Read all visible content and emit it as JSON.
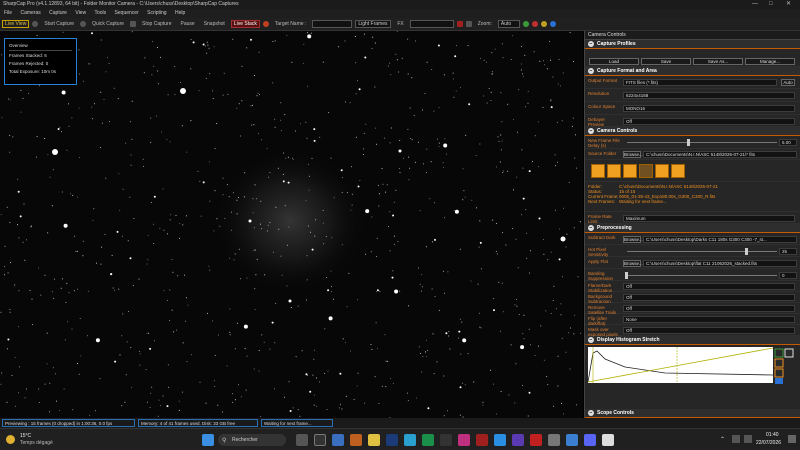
{
  "window": {
    "title": "SharpCap Pro (v4.1.12893, 64 bit) - Folder Monitor Camera - C:\\Users\\chuss\\Desktop\\SharpCap Captures"
  },
  "menu": [
    "File",
    "Cameras",
    "Capture",
    "View",
    "Tools",
    "Sequencer",
    "Scripting",
    "Help"
  ],
  "toolbar": {
    "live_view": "Live View",
    "start_capture": "Start Capture",
    "quick_capture": "Quick Capture",
    "stop_capture": "Stop Capture",
    "pause": "Pause",
    "snapshot": "Snapshot",
    "live_stack": "Live Stack",
    "target_name_label": "Target Name :",
    "target_name_value": "",
    "light_frames": "Light Frames",
    "fx_label": "FX",
    "fx_value": "",
    "zoom_label": "Zoom:",
    "zoom_value": "Auto"
  },
  "overview": {
    "title": "Overview",
    "frames_stacked": "Frames Stacked:  6",
    "frames_rejected": "Frames Rejected:  0",
    "total_exposure": "Total Exposure:     10m 0s"
  },
  "panel": {
    "title": "Camera Controls",
    "capture_profiles": {
      "header": "Capture Profiles",
      "load": "Load",
      "save": "Save",
      "save_as": "Save As...",
      "manage": "Manage..."
    },
    "capture_format": {
      "header": "Capture Format and Area",
      "output_format_label": "Output Format",
      "output_format": "FITS files (*.fits)",
      "auto": "Auto",
      "resolution_label": "Resolution",
      "resolution": "6224x4168",
      "colour_space_label": "Colour Space",
      "colour_space": "MONO16",
      "debayer_label": "Debayer Preview",
      "debayer": "Off"
    },
    "camera_controls": {
      "header": "Camera Controls",
      "new_frame_label": "New Frame File Delay (s)",
      "new_frame_value": "5.00",
      "source_folder_label": "Source Folder",
      "browse": "Browse...",
      "source_folder": "C:\\chuss\\Documents\\N.I.N\\ASC 5148\\2026-07-21\\* fits",
      "folder_label": "Folder:",
      "folder_value": "C:\\chuss\\Documents\\N.I.N\\ASC 5148\\2026-07-21",
      "status_label": "Status:",
      "status_value": "15 of 15",
      "current_frame_label": "Current Frame:",
      "current_frame_value": "0005_01-35-43_Exp180.00s_G300_C300_R.fits",
      "next_frames_label": "Next Frames:",
      "next_frames_value": "Waiting for next frame...",
      "frame_rate_label": "Frame Rate Limit",
      "frame_rate": "Maximum"
    },
    "preprocessing": {
      "header": "Preprocessing",
      "subtract_dark_label": "Subtract Dark",
      "subtract_dark": "C:\\Users\\chuss\\Desktop\\Darks C11 180s G300 C300 -7_st...",
      "hot_pixel_label": "Hot Pixel Sensitivity",
      "hot_pixel": "25",
      "apply_flat_label": "Apply Flat",
      "apply_flat": "C:\\Users\\chuss\\Desktop\\flat C11 21062026_stacked.fits",
      "banding_label": "Banding Suppression",
      "banding": "0",
      "flat_dark_label": "Flame/Dark Stabilization",
      "flat_dark": "Off",
      "background_label": "Background Subtraction",
      "background": "Off",
      "satellite_label": "Remove Satellite Trails",
      "satellite": "Off",
      "flip_label": "Flip (after dark/flat)",
      "flip": "None",
      "mask_label": "Mask over exposed pixels",
      "mask": "Off"
    },
    "histogram": {
      "header": "Display Histogram Stretch"
    },
    "scope": {
      "header": "Scope Controls"
    }
  },
  "status": {
    "previewing": "Previewing : 15 frames (0 dropped) in 1:00:36, 0.0 fps",
    "memory": "Memory: 4 of 41 frames used. Disk: 33 GB free",
    "waiting": "Waiting for next frame..."
  },
  "taskbar": {
    "temperature": "15°C",
    "weather": "Temps dégagé",
    "search": "Rechercher",
    "time": "01:40",
    "date": "22/07/2026"
  },
  "colors": {
    "accent": "#f09020",
    "panel_bg": "#262626",
    "overview_border": "#2a7fd4"
  }
}
